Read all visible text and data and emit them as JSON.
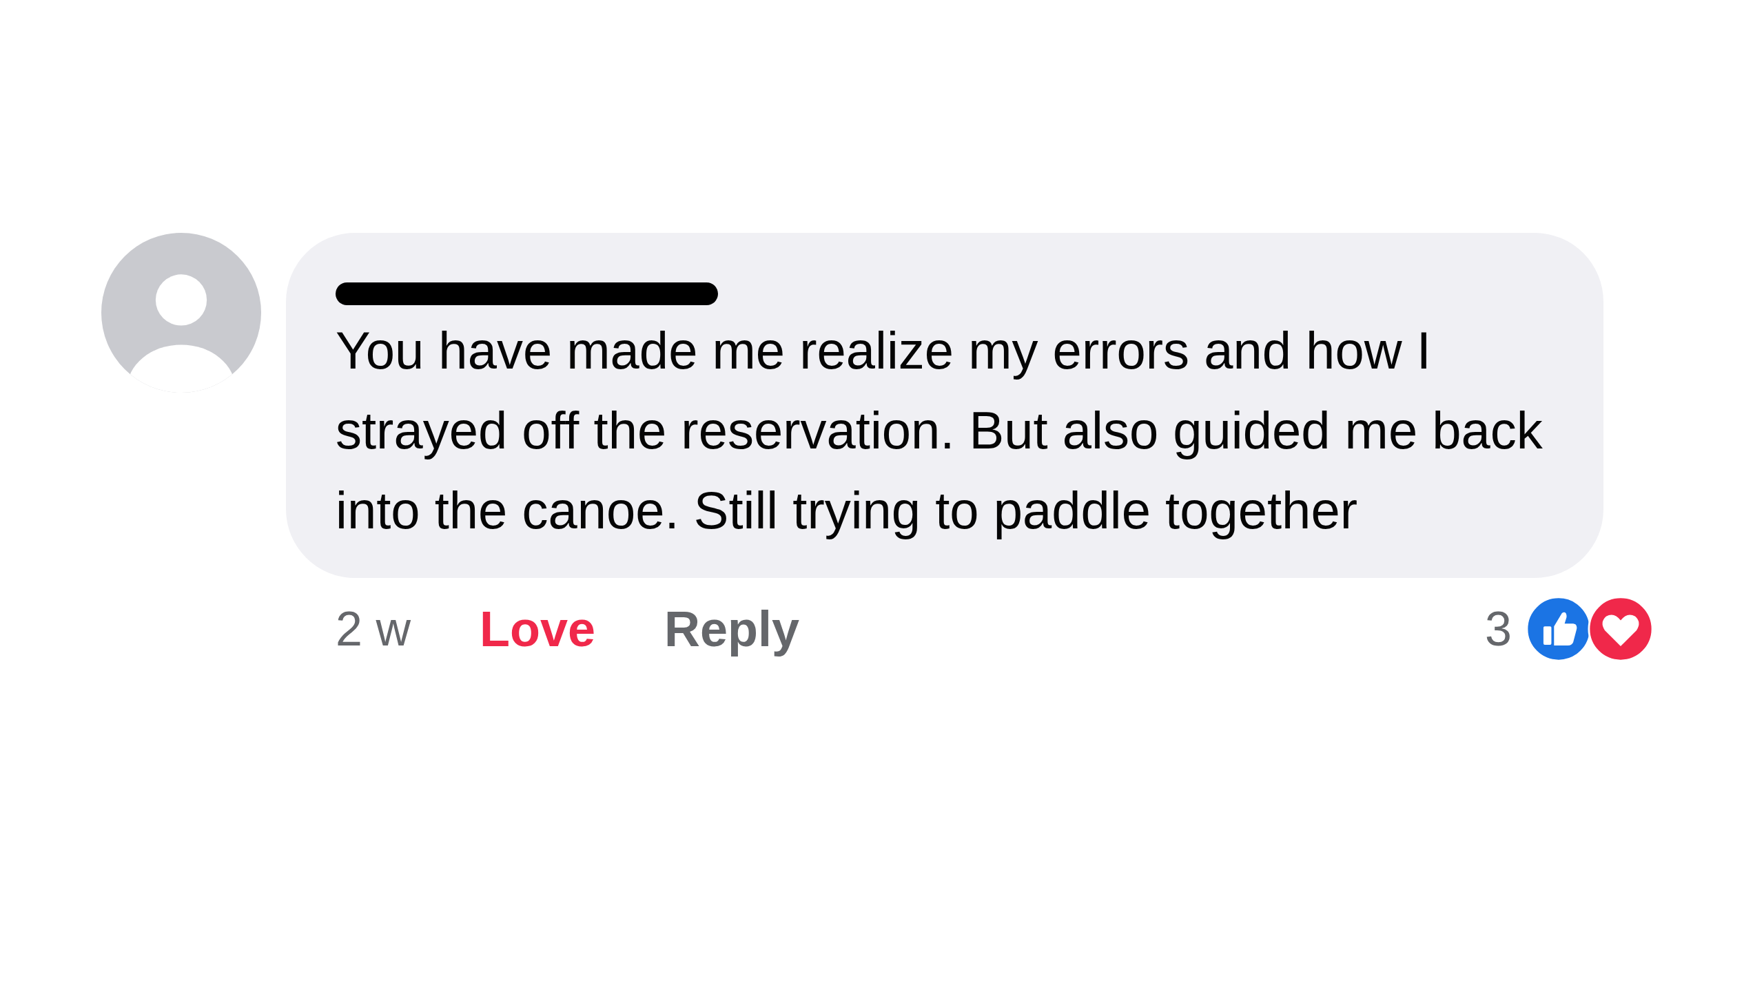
{
  "comment": {
    "author_redacted": true,
    "text": "You have made me realize my errors and how I strayed off the reservation. But also guided me back into the canoe. Still trying to paddle together"
  },
  "footer": {
    "time": "2 w",
    "reaction_button": {
      "label": "Love",
      "active": true
    },
    "reply": "Reply",
    "reaction_count": "3",
    "reactions": [
      {
        "kind": "like"
      },
      {
        "kind": "love"
      }
    ]
  }
}
